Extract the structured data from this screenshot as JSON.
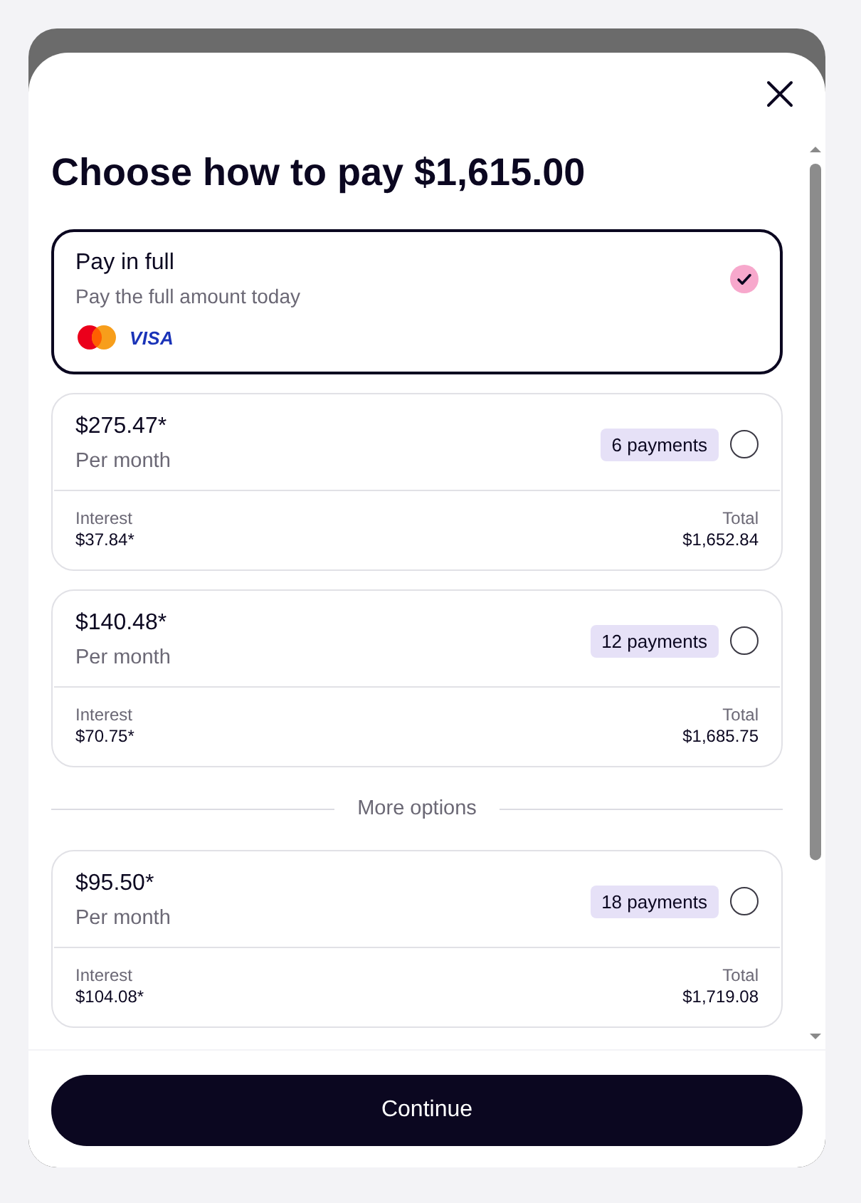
{
  "dialog": {
    "title": "Choose how to pay $1,615.00"
  },
  "items": [
    {
      "kind": "full",
      "title": "Pay in full",
      "subtitle": "Pay the full amount today",
      "selected": true,
      "methods": [
        {
          "kind": "mastercard"
        },
        {
          "kind": "visa",
          "label": "VISA"
        }
      ]
    },
    {
      "kind": "plan",
      "amount": "$275.47*",
      "period": "Per month",
      "badge": "6 payments",
      "selected": false,
      "interest_label": "Interest",
      "interest": "$37.84*",
      "total_label": "Total",
      "total": "$1,652.84"
    },
    {
      "kind": "plan",
      "amount": "$140.48*",
      "period": "Per month",
      "badge": "12 payments",
      "selected": false,
      "interest_label": "Interest",
      "interest": "$70.75*",
      "total_label": "Total",
      "total": "$1,685.75"
    },
    {
      "kind": "divider",
      "label": "More options"
    },
    {
      "kind": "plan",
      "amount": "$95.50*",
      "period": "Per month",
      "badge": "18 payments",
      "selected": false,
      "interest_label": "Interest",
      "interest": "$104.08*",
      "total_label": "Total",
      "total": "$1,719.08"
    }
  ],
  "continue_button": "Continue"
}
